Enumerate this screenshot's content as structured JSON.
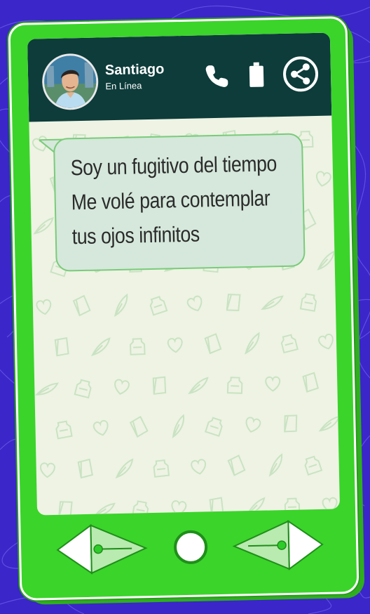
{
  "contact": {
    "name": "Santiago",
    "status": "En Línea"
  },
  "message": {
    "lines": [
      "Soy un fugitivo del tiempo",
      "Me volé para contemplar",
      "tus ojos infinitos"
    ]
  },
  "icons": {
    "call": "phone-icon",
    "battery": "battery-icon",
    "share": "share-icon",
    "prev": "arrow-left-icon",
    "home": "home-circle-icon",
    "next": "arrow-right-icon"
  },
  "colors": {
    "background": "#3a26c9",
    "phone_body": "#3bd42a",
    "header": "#0d3c3a",
    "bubble": "#d5e8db",
    "screen": "#eef3e4"
  }
}
